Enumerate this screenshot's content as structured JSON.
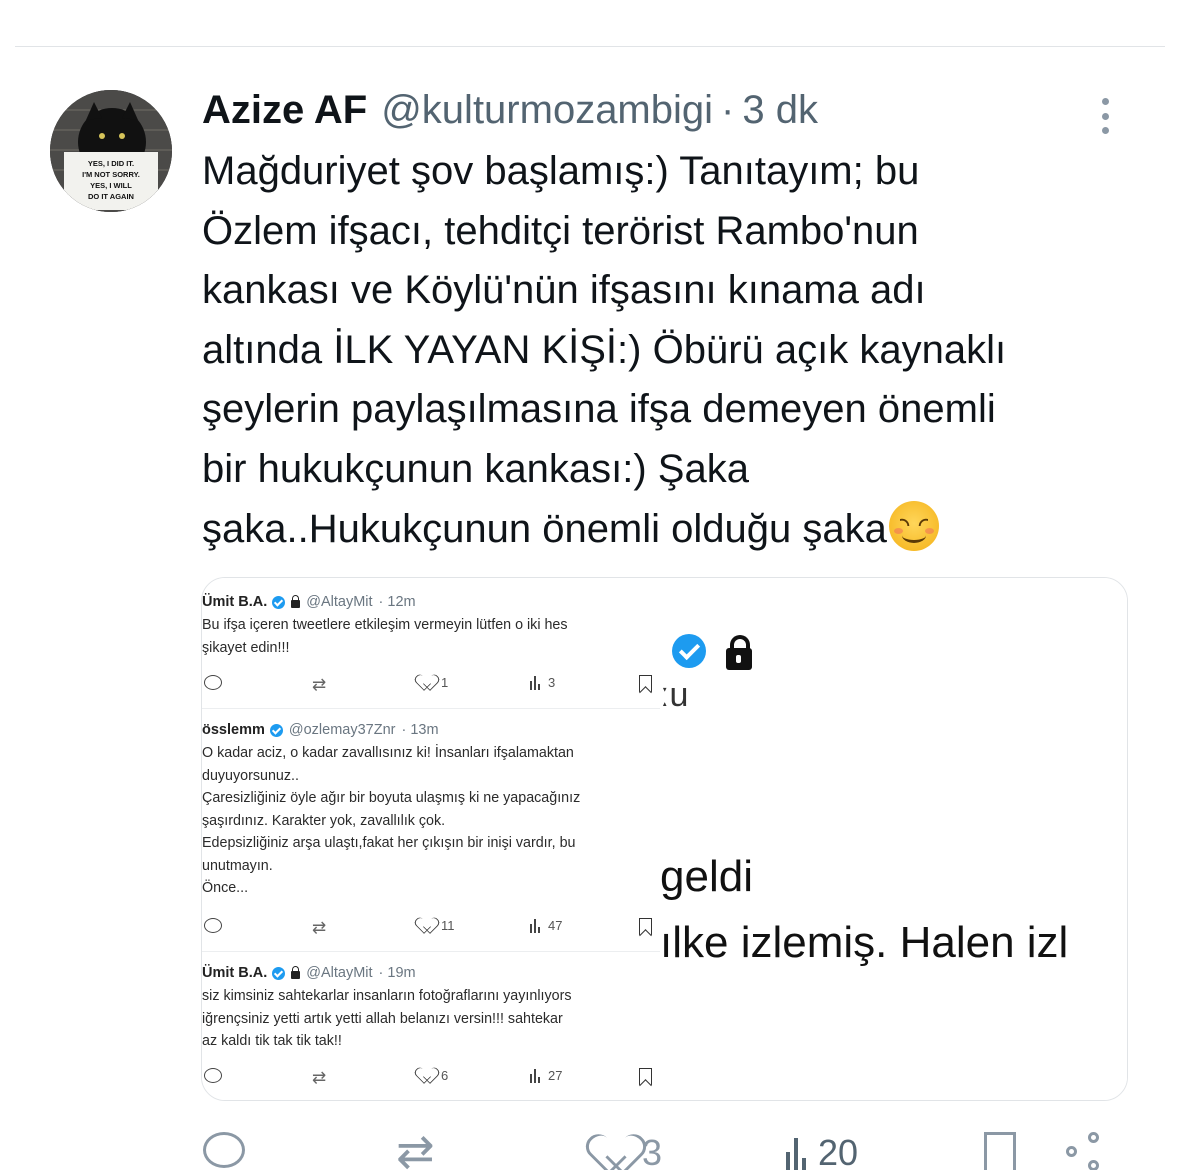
{
  "tweet": {
    "display_name": "Azize AF",
    "handle": "@kulturmozambigi",
    "separator": "·",
    "time": "3 dk",
    "avatar_sign_lines": [
      "YES, I DID IT.",
      "I'M NOT SORRY.",
      "YES, I WILL",
      "DO IT AGAIN"
    ],
    "text_lines": [
      "Mağduriyet şov başlamış:) Tanıtayım; bu",
      "Özlem ifşacı, tehditçi terörist Rambo'nun",
      "kankası ve Köylü'nün ifşasını kınama adı",
      "altında İLK YAYAN KİŞİ:) Öbürü açık kaynaklı",
      "şeylerin paylaşılmasına ifşa demeyen önemli",
      "bir hukukçunun kankası:) Şaka",
      "şaka..Hukukçunun önemli olduğu şaka"
    ],
    "stats": {
      "likes": "3",
      "views": "20"
    }
  },
  "embedded": {
    "tweets": [
      {
        "name": "Ümit B.A.",
        "handle": "@AltayMit",
        "time": "· 12m",
        "lines": [
          "Bu ifşa içeren tweetlere etkileşim vermeyin lütfen o iki hes",
          "şikayet edin!!!"
        ],
        "likes": "1",
        "views": "3"
      },
      {
        "name": "össlemm",
        "handle": "@ozlemay37Znr",
        "time": "· 13m",
        "lines": [
          "O kadar aciz, o kadar zavallısınız ki! İnsanları ifşalamaktan",
          "duyuyorsunuz..",
          "Çaresizliğiniz öyle ağır bir boyuta ulaşmış ki ne yapacağınız",
          "şaşırdınız. Karakter yok, zavallılık çok.",
          "Edepsizliğiniz arşa ulaştı,fakat her çıkışın bir inişi vardır, bu",
          "unutmayın.",
          "Önce..."
        ],
        "likes": "11",
        "views": "47"
      },
      {
        "name": "Ümit B.A.",
        "handle": "@AltayMit",
        "time": "· 19m",
        "lines": [
          "siz kimsiniz sahtekarlar insanların fotoğraflarını yayınlıyors",
          "iğrençsiniz yetti artık yetti allah belanızı versin!!! sahtekar",
          "az kaldı tik tak tik tak!!"
        ],
        "likes": "6",
        "views": "27"
      }
    ],
    "right_fragments": [
      "ːu",
      "geldi",
      "ılke izlemiş. Halen izl"
    ]
  },
  "colors": {
    "accent": "#1d9bf0",
    "muted": "#536471",
    "text": "#0f1419"
  },
  "icons": [
    "more-icon",
    "reply-icon",
    "retweet-icon",
    "like-icon",
    "views-icon",
    "bookmark-icon",
    "share-icon",
    "verified-icon",
    "lock-icon"
  ]
}
